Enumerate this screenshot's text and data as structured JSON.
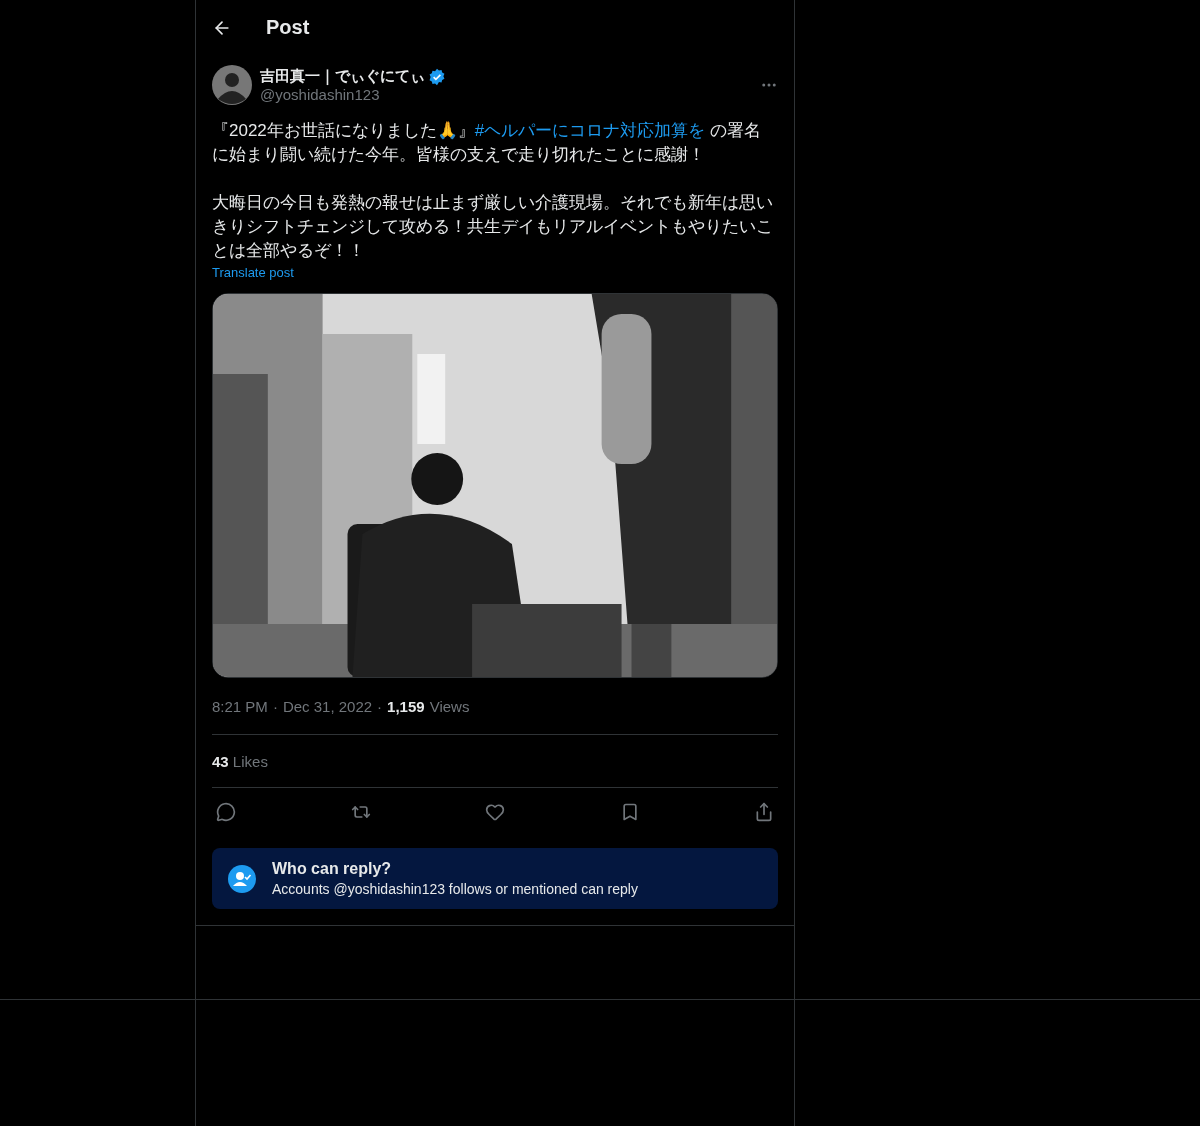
{
  "header": {
    "title": "Post"
  },
  "author": {
    "name": "吉田真一｜でぃぐにてぃ",
    "handle": "@yoshidashin123",
    "verified": true
  },
  "body": [
    {
      "parts": [
        {
          "kind": "text",
          "text": "『2022年お世話になりました🙏』"
        },
        {
          "kind": "hashtag",
          "text": "#ヘルパーにコロナ対応加算を"
        },
        {
          "kind": "text",
          "text": " の署名に始まり闘い続けた今年。皆様の支えで走り切れたことに感謝！"
        }
      ]
    },
    {
      "parts": [
        {
          "kind": "text",
          "text": "大晦日の今日も発熱の報せは止まず厳しい介護現場。それでも新年は思いきりシフトチェンジして攻める！共生デイもリアルイベントもやりたいことは全部やるぞ！！"
        }
      ]
    }
  ],
  "translate": "Translate post",
  "meta": {
    "time": "8:21 PM",
    "separator_1": "·",
    "date": "Dec 31, 2022",
    "separator_2": "·",
    "views_count": "1,159",
    "views_label": "Views"
  },
  "likes": {
    "count": "43",
    "label": "Likes"
  },
  "actions": [
    {
      "kind": "reply"
    },
    {
      "kind": "repost"
    },
    {
      "kind": "like"
    },
    {
      "kind": "bookmark"
    },
    {
      "kind": "share"
    }
  ],
  "reply_notice": {
    "title": "Who can reply?",
    "text": "Accounts @yoshidashin123 follows or mentioned can reply"
  }
}
